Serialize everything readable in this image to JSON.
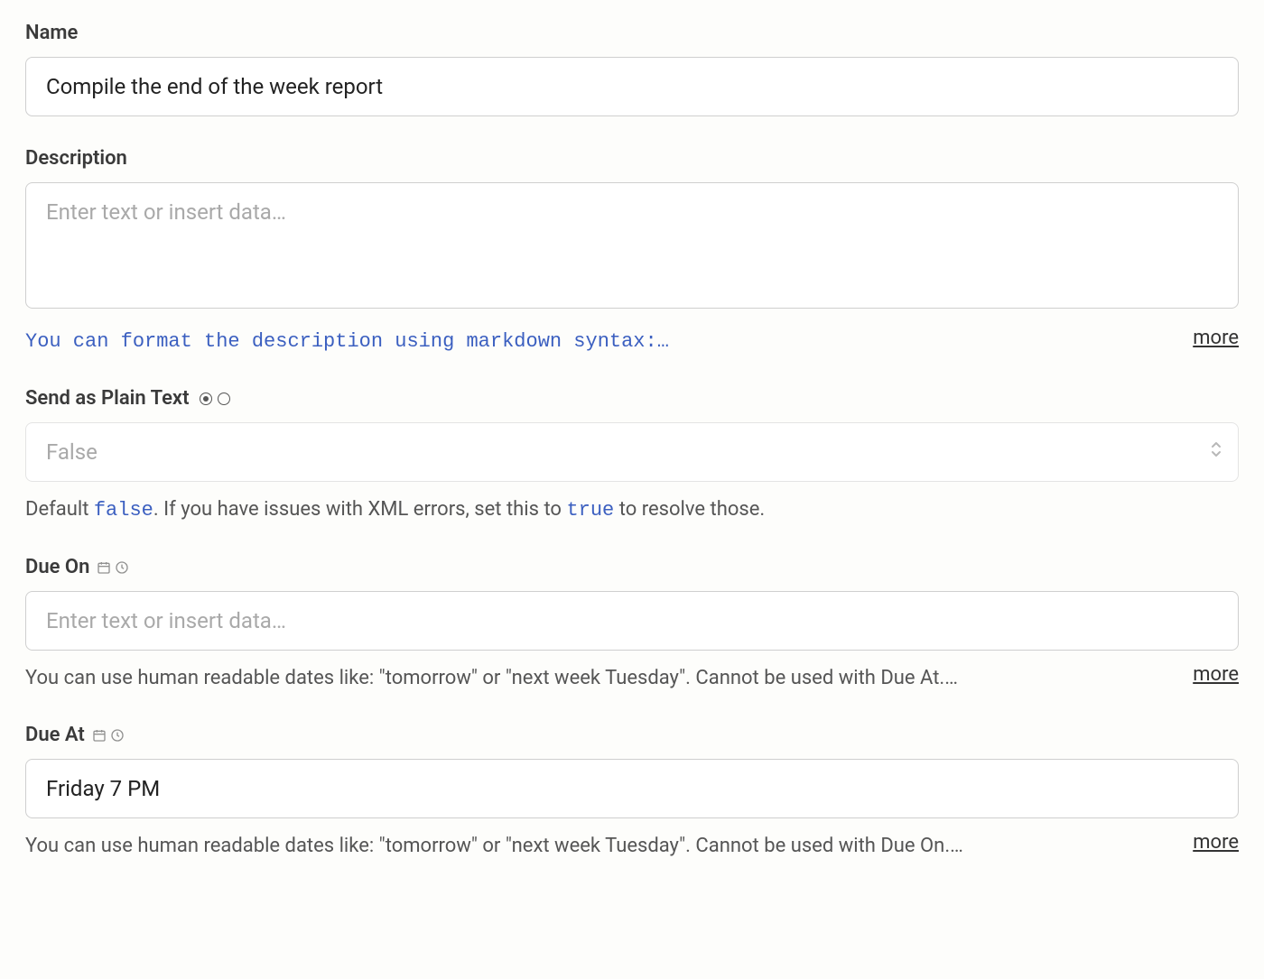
{
  "name": {
    "label": "Name",
    "value": "Compile the end of the week report"
  },
  "description": {
    "label": "Description",
    "placeholder": "Enter text or insert data…",
    "helper": "You can format the description using markdown syntax:…",
    "more": "more"
  },
  "send_plain": {
    "label": "Send as Plain Text",
    "value": "False",
    "helper_prefix": "Default ",
    "helper_code1": "false",
    "helper_mid": ". If you have issues with XML errors, set this to ",
    "helper_code2": "true",
    "helper_suffix": " to resolve those."
  },
  "due_on": {
    "label": "Due On",
    "placeholder": "Enter text or insert data…",
    "helper": "You can use human readable dates like: \"tomorrow\" or \"next week Tuesday\". Cannot be used with Due At.…",
    "more": "more"
  },
  "due_at": {
    "label": "Due At",
    "value": "Friday 7 PM",
    "helper": "You can use human readable dates like: \"tomorrow\" or \"next week Tuesday\". Cannot be used with Due On.…",
    "more": "more"
  }
}
